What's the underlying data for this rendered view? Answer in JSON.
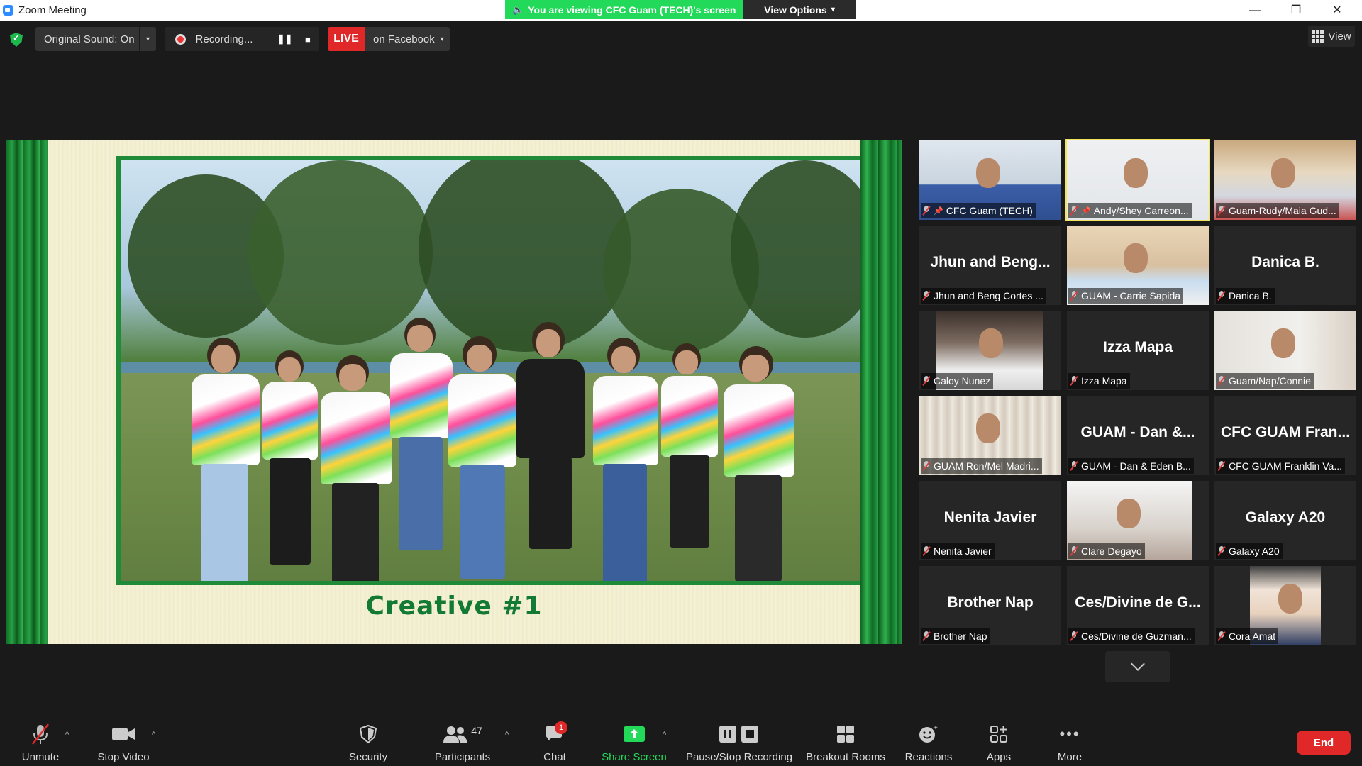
{
  "window": {
    "title": "Zoom Meeting",
    "minimize": "—",
    "restore": "❐",
    "close": "✕"
  },
  "banner": {
    "message": "You are viewing CFC Guam (TECH)'s screen",
    "view_options": "View Options"
  },
  "controls": {
    "original_sound": "Original Sound: On",
    "recording": "Recording...",
    "live": "LIVE",
    "live_target": "on Facebook",
    "view": "View"
  },
  "shared_screen": {
    "caption": "Creative #1"
  },
  "gallery": [
    {
      "name": "CFC Guam (TECH)",
      "big": "",
      "pinned": true,
      "video": true
    },
    {
      "name": "Andy/Shey Carreon...",
      "big": "",
      "pinned": true,
      "video": true,
      "active": true
    },
    {
      "name": "Guam-Rudy/Maia Gud...",
      "big": "",
      "pinned": false,
      "video": true
    },
    {
      "name": "Jhun and Beng Cortes ...",
      "big": "Jhun and Beng...",
      "pinned": false,
      "video": false
    },
    {
      "name": "GUAM - Carrie Sapida",
      "big": "",
      "pinned": false,
      "video": true
    },
    {
      "name": "Danica B.",
      "big": "Danica B.",
      "pinned": false,
      "video": false
    },
    {
      "name": "Caloy Nunez",
      "big": "",
      "pinned": false,
      "video": true
    },
    {
      "name": "Izza Mapa",
      "big": "Izza Mapa",
      "pinned": false,
      "video": false
    },
    {
      "name": "Guam/Nap/Connie",
      "big": "",
      "pinned": false,
      "video": true
    },
    {
      "name": "GUAM Ron/Mel Madri...",
      "big": "",
      "pinned": false,
      "video": true
    },
    {
      "name": "GUAM - Dan & Eden B...",
      "big": "GUAM - Dan &...",
      "pinned": false,
      "video": false
    },
    {
      "name": "CFC GUAM Franklin Va...",
      "big": "CFC GUAM Fran...",
      "pinned": false,
      "video": false
    },
    {
      "name": "Nenita Javier",
      "big": "Nenita Javier",
      "pinned": false,
      "video": false
    },
    {
      "name": "Clare Degayo",
      "big": "",
      "pinned": false,
      "video": true
    },
    {
      "name": "Galaxy A20",
      "big": "Galaxy A20",
      "pinned": false,
      "video": false
    },
    {
      "name": "Brother Nap",
      "big": "Brother Nap",
      "pinned": false,
      "video": false
    },
    {
      "name": "Ces/Divine de Guzman...",
      "big": "Ces/Divine de G...",
      "pinned": false,
      "video": false
    },
    {
      "name": "Cora Amat",
      "big": "",
      "pinned": false,
      "video": true
    }
  ],
  "toolbar": {
    "unmute": "Unmute",
    "stop_video": "Stop Video",
    "security": "Security",
    "participants": "Participants",
    "participants_count": "47",
    "chat": "Chat",
    "chat_badge": "1",
    "share_screen": "Share Screen",
    "pause_stop_recording": "Pause/Stop Recording",
    "breakout_rooms": "Breakout Rooms",
    "reactions": "Reactions",
    "apps": "Apps",
    "more": "More",
    "end": "End"
  },
  "colors": {
    "accent_green": "#23d959",
    "live_red": "#e02828",
    "active_speaker": "#f2e45b",
    "curtain_green": "#1f8a38"
  }
}
